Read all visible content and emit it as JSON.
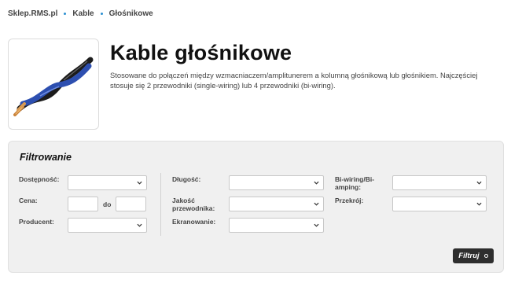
{
  "breadcrumb": {
    "items": [
      "Sklep.RMS.pl",
      "Kable",
      "Głośnikowe"
    ]
  },
  "product": {
    "title": "Kable głośnikowe",
    "description": "Stosowane do połączeń między wzmacniaczem/amplitunerem a kolumną głośnikową lub głośnikiem. Najczęściej stosuje się 2 przewodniki (single-wiring) lub 4 przewodniki (bi-wiring)."
  },
  "filter": {
    "title": "Filtrowanie",
    "labels": {
      "dostepnosc": "Dostępność:",
      "cena": "Cena:",
      "do": "do",
      "producent": "Producent:",
      "dlugosc": "Długość:",
      "jakosc": "Jakość przewodnika:",
      "ekranowanie": "Ekranowanie:",
      "biwiring": "Bi-wiring/Bi-amping:",
      "przekroj": "Przekrój:"
    },
    "button_label": "Filtruj"
  },
  "colors": {
    "accent_blue": "#2a8fd1",
    "panel_bg": "#f0f0f0",
    "button_bg": "#2e2e2e"
  }
}
